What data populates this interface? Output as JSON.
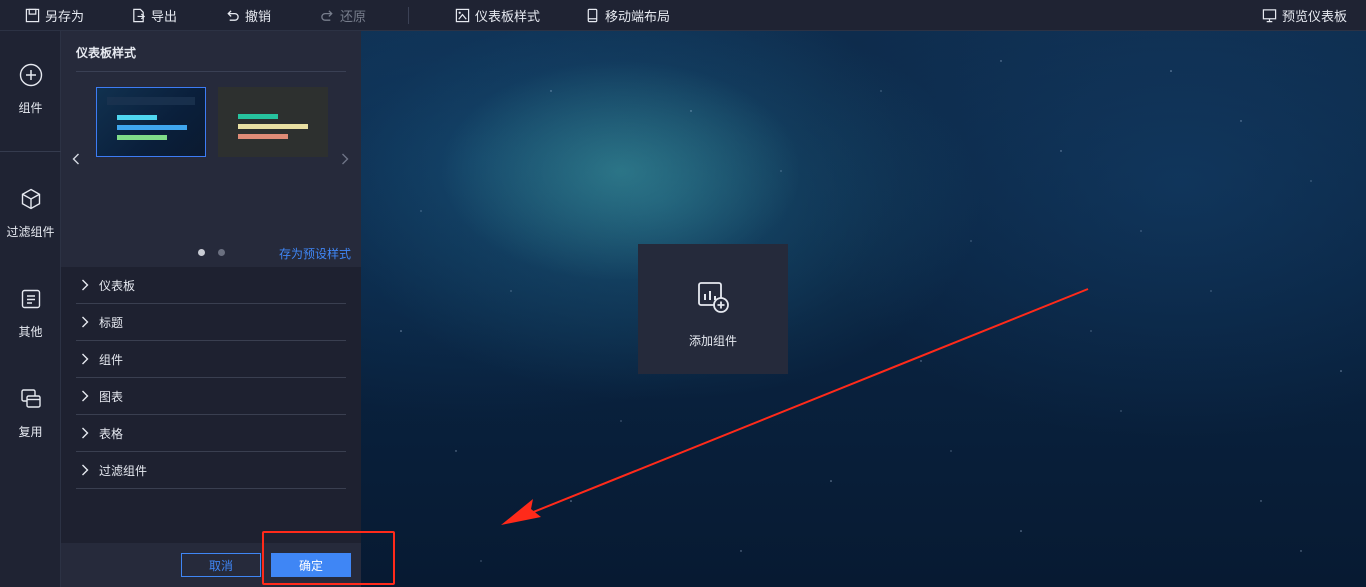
{
  "toolbar": {
    "save_as": "另存为",
    "export": "导出",
    "undo": "撤销",
    "redo": "还原",
    "dashboard_style": "仪表板样式",
    "mobile_layout": "移动端布局",
    "preview": "预览仪表板"
  },
  "sidebar": {
    "items": [
      {
        "label": "组件",
        "icon": "plus-circle-icon"
      },
      {
        "label": "过滤组件",
        "icon": "cube-icon"
      },
      {
        "label": "其他",
        "icon": "document-icon"
      },
      {
        "label": "复用",
        "icon": "copy-icon"
      }
    ]
  },
  "panel": {
    "title": "仪表板样式",
    "save_preset": "存为预设样式",
    "sections": [
      "仪表板",
      "标题",
      "组件",
      "图表",
      "表格",
      "过滤组件"
    ],
    "cancel": "取消",
    "confirm": "确定"
  },
  "canvas": {
    "add_component": "添加组件"
  },
  "colors": {
    "accent": "#3f86f5",
    "annotation": "#ff2a1a"
  }
}
